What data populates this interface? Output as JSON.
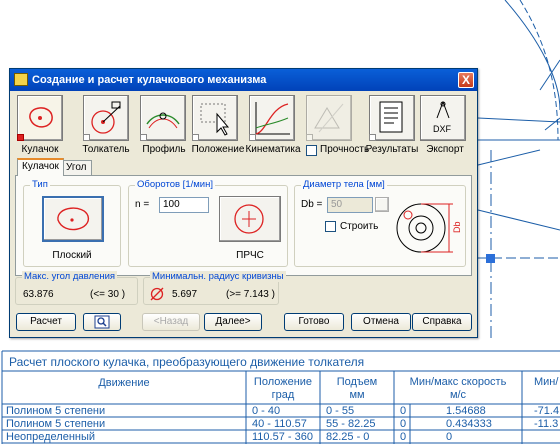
{
  "dialog": {
    "title": "Создание и расчет кулачкового механизма",
    "close": "X",
    "toolbar": [
      {
        "label": "Кулачок",
        "icon": "cam-icon"
      },
      {
        "label": "Толкатель",
        "icon": "follower-icon"
      },
      {
        "label": "Профиль",
        "icon": "profile-icon"
      },
      {
        "label": "Положение",
        "icon": "position-icon"
      },
      {
        "label": "Кинематика",
        "icon": "kinematics-icon"
      },
      {
        "label": "Прочность",
        "icon": "strength-icon"
      },
      {
        "label": "Результаты",
        "icon": "results-icon"
      },
      {
        "label": "Экспорт",
        "icon": "export-dxf-icon",
        "badge": "DXF"
      }
    ],
    "tabs": [
      "Кулачок",
      "Угол"
    ],
    "type_group": {
      "label": "Тип",
      "button_label": "Плоский"
    },
    "rpm_group": {
      "label": "Оборотов  [1/мин]",
      "n_label": "n =",
      "n_value": "100",
      "button_label": "ПРЧС"
    },
    "diam_group": {
      "label": "Диаметр тела [мм]",
      "db_label": "Db =",
      "db_value": "50",
      "build_label": "Строить",
      "dim_text": "Db"
    },
    "pressure": {
      "label": "Макс. угол давления",
      "value": "63.876",
      "limit": "(<= 30 )"
    },
    "curvature": {
      "label": "Минимальн. радиус кривизны",
      "value": "5.697",
      "limit": "(>= 7.143 )"
    },
    "buttons": {
      "calc": "Расчет",
      "back": "<Назад",
      "next": "Далее>",
      "done": "Готово",
      "cancel": "Отмена",
      "help": "Справка"
    }
  },
  "sheet": {
    "title": "Расчет плоского кулачка, преобразующего движение толкателя",
    "headers": {
      "motion": "Движение",
      "pos1": "Положение",
      "pos2": "град",
      "lift1": "Подъем",
      "lift2": "мм",
      "vel1": "Мин/макс скорость",
      "vel2": "м/с",
      "min": "Мин/"
    },
    "rows": [
      {
        "motion": "Полином 5 степени",
        "pos": "0 - 40",
        "lift": "0 - 55",
        "vmin": "0",
        "vmax": "1.54688",
        "extra": "-71.4"
      },
      {
        "motion": "Полином 5 степени",
        "pos": "40 - 110.57",
        "lift": "55 - 82.25",
        "vmin": "0",
        "vmax": "0.434333",
        "extra": "-11.3"
      },
      {
        "motion": "Неопределенный",
        "pos": "110.57 - 360",
        "lift": "82.25 - 0",
        "vmin": "0",
        "vmax": "0",
        "extra": ""
      }
    ]
  }
}
